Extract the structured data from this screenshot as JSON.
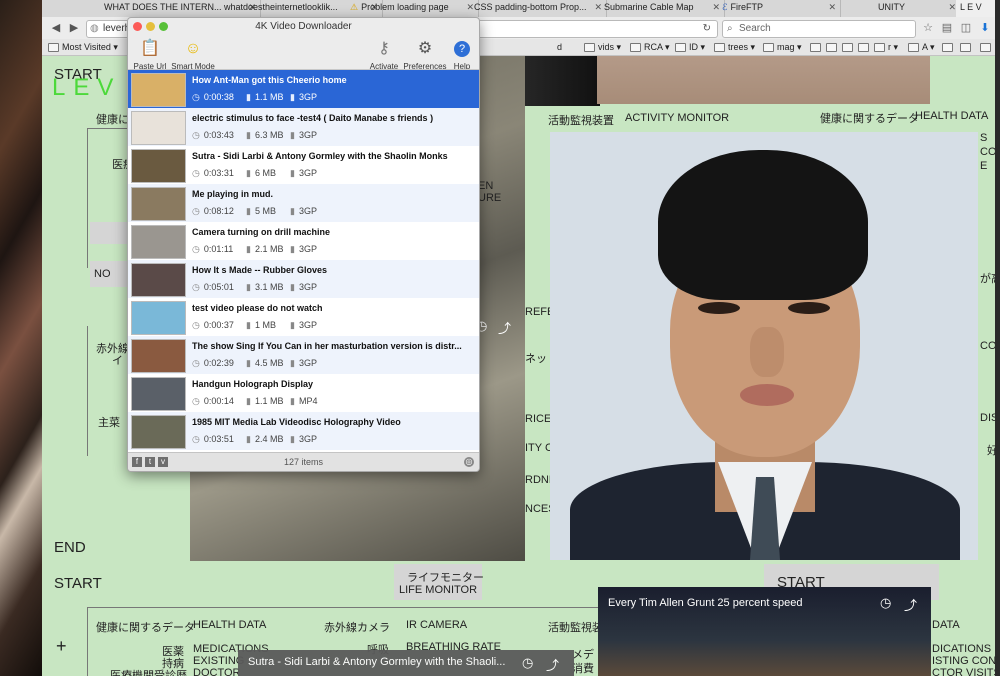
{
  "browser": {
    "tabs": [
      {
        "label": "WHAT DOES THE INTERN...",
        "icon": ""
      },
      {
        "label": "whatdoestheinternetlooklik...",
        "icon": ""
      },
      {
        "label": "Problem loading page",
        "icon": "warning-icon"
      },
      {
        "label": "CSS padding-bottom Prop...",
        "icon": ""
      },
      {
        "label": "Submarine Cable Map",
        "icon": ""
      },
      {
        "label": "FireFTP",
        "icon": "fireftp-icon"
      },
      {
        "label": "UNITY",
        "icon": ""
      },
      {
        "label": "L E V",
        "icon": ""
      }
    ],
    "url": "leverhu",
    "search_placeholder": "Search",
    "bookmarks": [
      "Most Visited",
      "d",
      "vids",
      "RCA",
      "ID",
      "trees",
      "mag",
      "r",
      "A"
    ]
  },
  "page": {
    "start_top": "START",
    "logo": "LEV",
    "health_data_jp": "健康に関するデータ",
    "health_data_en": "HEALTH DATA",
    "activity_jp": "活動監視装置",
    "activity_en": "ACTIVITY MONITOR",
    "health_data_right": "HEALTH DATA",
    "no": "NO",
    "medicine": "医療",
    "infrared_left": "赤外線カ",
    "infra_i": "イ",
    "main_dish": "主菜",
    "end": "END",
    "start_mid": "START",
    "life_monitor_jp": "ライフモニター",
    "life_monitor_en": "LIFE MONITOR",
    "start_right": "START",
    "bottom_health_jp": "健康に関するデータ",
    "bottom_health_en": "HEALTH DATA",
    "ir_camera_jp": "赤外線カメラ",
    "ir_camera_en": "IR CAMERA",
    "activity_jp2": "活動監視装",
    "medications_jp": "医薬",
    "medications": "MEDICATIONS",
    "existing_jp": "持病",
    "existing": "EXISTING",
    "doctor_jp": "医療機関受診歴",
    "doctor": "DOCTOR",
    "breathing_jp": "呼吸",
    "breathing": "BREATHING RATE",
    "plus": "+",
    "bottom_video_title": "Sutra - Sidi Larbi & Antony Gormley with the Shaoli...",
    "video_bottom_right_title": "Every Tim Allen Grunt 25 percent speed",
    "right_edge": [
      "S",
      "CONDIT",
      "E",
      "が高",
      "CORD",
      "DISI",
      "好き"
    ],
    "right_bottom": [
      "DATA",
      "DICATIONS",
      "ISTING CONDIT",
      "CTOR VISITS"
    ],
    "mid_labels": [
      "ソー",
      "EN",
      "URE",
      "REFERENC",
      "ネット",
      "RICE",
      "ITY C",
      "RDNE",
      "NCES"
    ],
    "jp_right_bottom": [
      "メデ",
      "消費"
    ]
  },
  "downloader": {
    "title": "4K Video Downloader",
    "tools": {
      "paste": "Paste Url",
      "smart": "Smart Mode",
      "activate": "Activate",
      "prefs": "Preferences",
      "help": "Help"
    },
    "items": [
      {
        "title": "How Ant-Man got this Cheerio home",
        "duration": "0:00:38",
        "size": "1.1 MB",
        "format": "3GP",
        "thumb": "#d9b067"
      },
      {
        "title": "electric stimulus to face -test4 ( Daito Manabe  s friends )",
        "duration": "0:03:43",
        "size": "6.3 MB",
        "format": "3GP",
        "thumb": "#e8e2da"
      },
      {
        "title": "Sutra - Sidi Larbi & Antony Gormley with the Shaolin Monks",
        "duration": "0:03:31",
        "size": "6 MB",
        "format": "3GP",
        "thumb": "#6a5a40"
      },
      {
        "title": "Me playing in mud.",
        "duration": "0:08:12",
        "size": "5 MB",
        "format": "3GP",
        "thumb": "#8a7a60"
      },
      {
        "title": "Camera turning on drill machine",
        "duration": "0:01:11",
        "size": "2.1 MB",
        "format": "3GP",
        "thumb": "#9a9690"
      },
      {
        "title": "How It s Made -- Rubber Gloves",
        "duration": "0:05:01",
        "size": "3.1 MB",
        "format": "3GP",
        "thumb": "#5a4a48"
      },
      {
        "title": "test video please do not watch",
        "duration": "0:00:37",
        "size": "1 MB",
        "format": "3GP",
        "thumb": "#7ab8d8"
      },
      {
        "title": "The show  Sing If You Can  in her masturbation version is distr...",
        "duration": "0:02:39",
        "size": "4.5 MB",
        "format": "3GP",
        "thumb": "#8a5a40"
      },
      {
        "title": "Handgun Holograph Display",
        "duration": "0:00:14",
        "size": "1.1 MB",
        "format": "MP4",
        "thumb": "#5a6068"
      },
      {
        "title": "1985 MIT Media Lab Videodisc Holography Video",
        "duration": "0:03:51",
        "size": "2.4 MB",
        "format": "3GP",
        "thumb": "#6a6a58"
      }
    ],
    "count": "127 items"
  }
}
